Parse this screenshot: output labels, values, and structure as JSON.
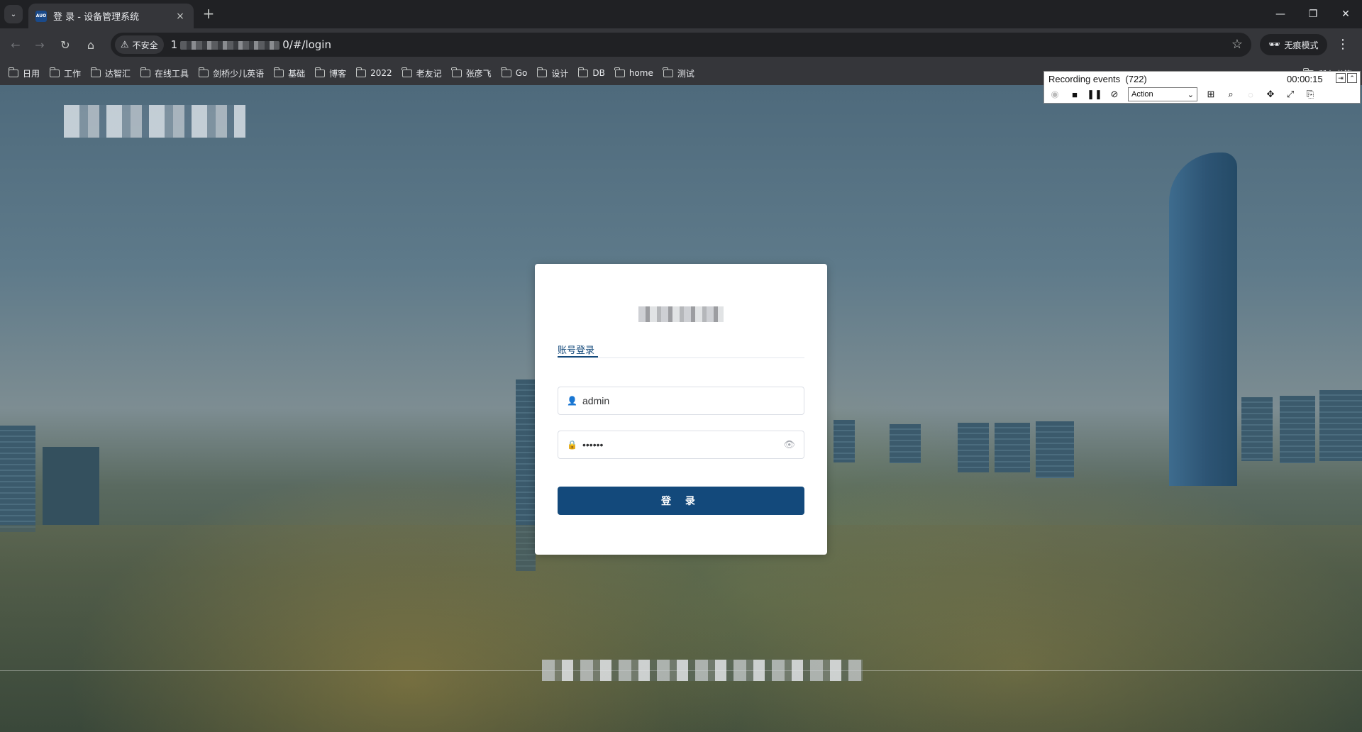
{
  "browser": {
    "tab": {
      "favicon_text": "AUO",
      "title": "登 录 - 设备管理系统",
      "close_label": "×"
    },
    "new_tab_label": "+",
    "window_controls": {
      "minimize": "—",
      "restore": "❐",
      "close": "✕"
    },
    "toolbar": {
      "back": "←",
      "forward": "→",
      "reload": "↻",
      "home": "⌂",
      "security_label": "不安全",
      "url_prefix": "1",
      "url_suffix": "0/#/login",
      "bookmark_star": "☆",
      "incognito_label": "无痕模式",
      "menu": "⋮"
    },
    "bookmarks": [
      "日用",
      "工作",
      "达智汇",
      "在线工具",
      "剑桥少儿英语",
      "基础",
      "博客",
      "2022",
      "老友记",
      "张彦飞",
      "Go",
      "设计",
      "DB",
      "home",
      "测试"
    ],
    "other_bookmarks_label": "所有书签"
  },
  "recorder": {
    "title": "Recording events",
    "count": "(722)",
    "time": "00:00:15",
    "mode_selected": "Action"
  },
  "login": {
    "tab_label": "账号登录",
    "username_value": "admin",
    "password_value": "••••••",
    "submit_label": "登 录"
  },
  "colors": {
    "primary": "#13497b",
    "browser_dark": "#202124",
    "browser_toolbar": "#35363a"
  }
}
